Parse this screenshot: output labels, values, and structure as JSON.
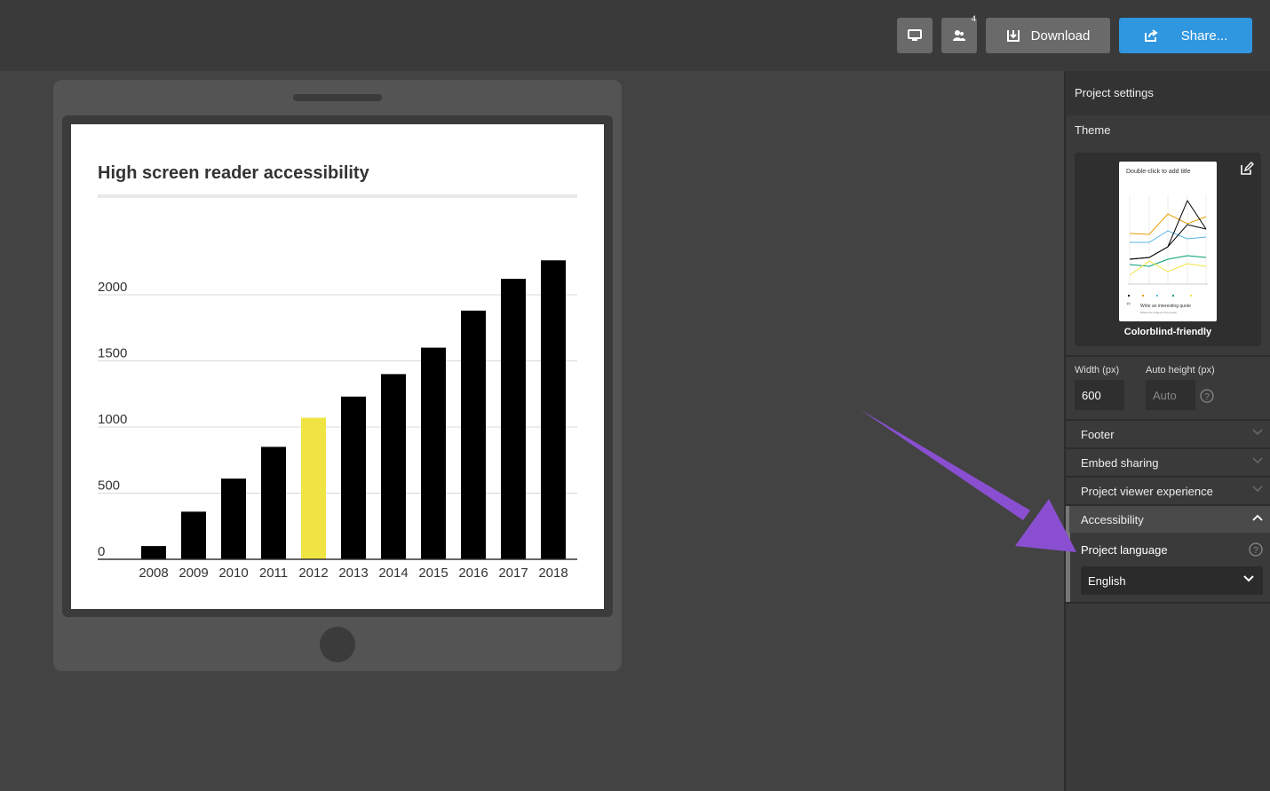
{
  "toolbar": {
    "collab_count": "4",
    "download_label": "Download",
    "share_label": "Share..."
  },
  "chart_data": {
    "type": "bar",
    "title": "High screen reader accessibility",
    "categories": [
      "2008",
      "2009",
      "2010",
      "2011",
      "2012",
      "2013",
      "2014",
      "2015",
      "2016",
      "2017",
      "2018"
    ],
    "values": [
      100,
      360,
      610,
      850,
      1070,
      1230,
      1400,
      1600,
      1880,
      2120,
      2260
    ],
    "highlight_index": 4,
    "highlight_color": "#f0e442",
    "bar_color": "#000000",
    "y_ticks": [
      "0",
      "500",
      "1000",
      "1500",
      "2000"
    ],
    "y_tick_values": [
      0,
      500,
      1000,
      1500,
      2000
    ],
    "ylim": [
      0,
      2500
    ],
    "grid": true
  },
  "panel": {
    "header": "Project settings",
    "theme_label": "Theme",
    "theme_name": "Colorblind-friendly",
    "theme_thumb_title": "Double-click to add title",
    "theme_thumb_quote": "Write an interesting quote",
    "theme_thumb_quote_sub": "Where the subject of the quote",
    "width_label": "Width (px)",
    "width_value": "600",
    "height_label": "Auto height (px)",
    "height_placeholder": "Auto",
    "sections": {
      "footer": "Footer",
      "embed": "Embed sharing",
      "viewer": "Project viewer experience",
      "accessibility": "Accessibility"
    },
    "language_label": "Project language",
    "language_value": "English"
  },
  "colors": {
    "share_button": "#2f97e0",
    "annotation_arrow": "#8a4fd1"
  }
}
